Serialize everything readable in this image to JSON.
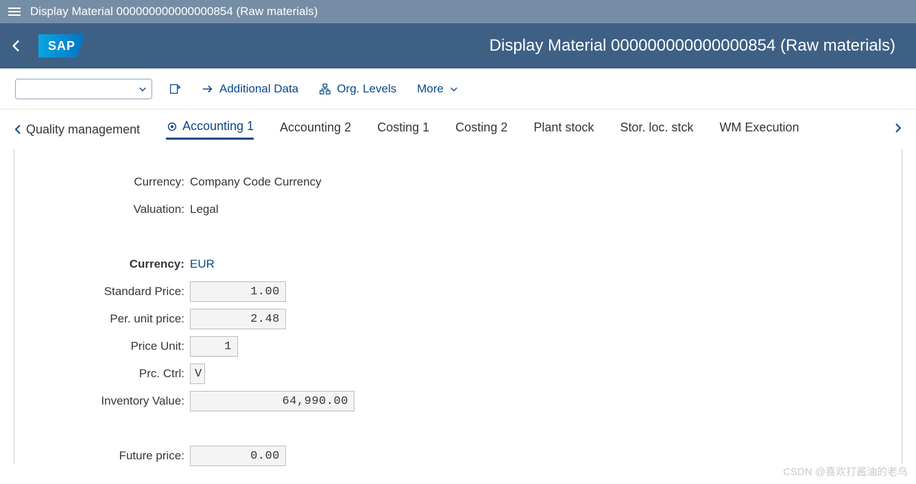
{
  "shell": {
    "title": "Display Material 000000000000000854 (Raw materials)"
  },
  "header": {
    "title": "Display Material 000000000000000854 (Raw materials)",
    "logo_text": "SAP"
  },
  "toolbar": {
    "additional_data": "Additional Data",
    "org_levels": "Org. Levels",
    "more": "More"
  },
  "tabs": {
    "prev": "Quality management",
    "items": [
      "Accounting 1",
      "Accounting 2",
      "Costing 1",
      "Costing 2",
      "Plant stock",
      "Stor. loc. stck",
      "WM Execution"
    ]
  },
  "form": {
    "currency_type_label": "Currency:",
    "currency_type_value": "Company Code Currency",
    "valuation_label": "Valuation:",
    "valuation_value": "Legal",
    "currency_label": "Currency:",
    "currency_value": "EUR",
    "standard_price_label": "Standard Price:",
    "standard_price_value": "1.00",
    "per_unit_price_label": "Per. unit price:",
    "per_unit_price_value": "2.48",
    "price_unit_label": "Price Unit:",
    "price_unit_value": "1",
    "prc_ctrl_label": "Prc. Ctrl:",
    "prc_ctrl_value": "V",
    "inventory_value_label": "Inventory Value:",
    "inventory_value_value": "64,990.00",
    "future_price_label": "Future price:",
    "future_price_value": "0.00"
  },
  "watermark": "CSDN @喜欢打酱油的老鸟"
}
